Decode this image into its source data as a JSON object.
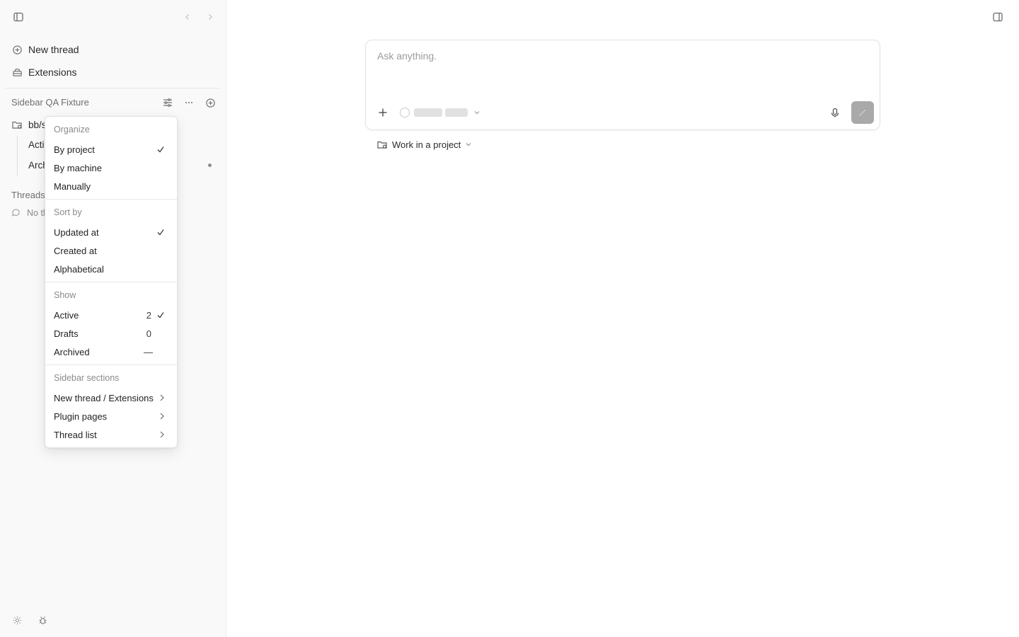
{
  "sidebar": {
    "new_thread": "New thread",
    "extensions": "Extensions",
    "workspace_title": "Sidebar QA Fixture",
    "project": {
      "name": "bb/s",
      "children": [
        "Acti",
        "Arch"
      ]
    },
    "threads_title": "Threads",
    "threads_empty": "No th"
  },
  "menu": {
    "groups": [
      {
        "title": "Organize",
        "items": [
          {
            "label": "By project",
            "checked": true
          },
          {
            "label": "By machine",
            "checked": false
          },
          {
            "label": "Manually",
            "checked": false
          }
        ]
      },
      {
        "title": "Sort by",
        "items": [
          {
            "label": "Updated at",
            "checked": true
          },
          {
            "label": "Created at",
            "checked": false
          },
          {
            "label": "Alphabetical",
            "checked": false
          }
        ]
      },
      {
        "title": "Show",
        "items": [
          {
            "label": "Active",
            "count": "2",
            "checked": true
          },
          {
            "label": "Drafts",
            "count": "0",
            "checked": false
          },
          {
            "label": "Archived",
            "count": "—",
            "checked": false
          }
        ]
      },
      {
        "title": "Sidebar sections",
        "items": [
          {
            "label": "New thread / Extensions",
            "submenu": true
          },
          {
            "label": "Plugin pages",
            "submenu": true
          },
          {
            "label": "Thread list",
            "submenu": true
          }
        ]
      }
    ]
  },
  "composer": {
    "placeholder": "Ask anything."
  },
  "project_picker": {
    "label": "Work in a project"
  },
  "colors": {
    "sidebar_bg": "#f9f9f9",
    "send_button": "#a9a9a9",
    "border": "#e2e2e2"
  }
}
